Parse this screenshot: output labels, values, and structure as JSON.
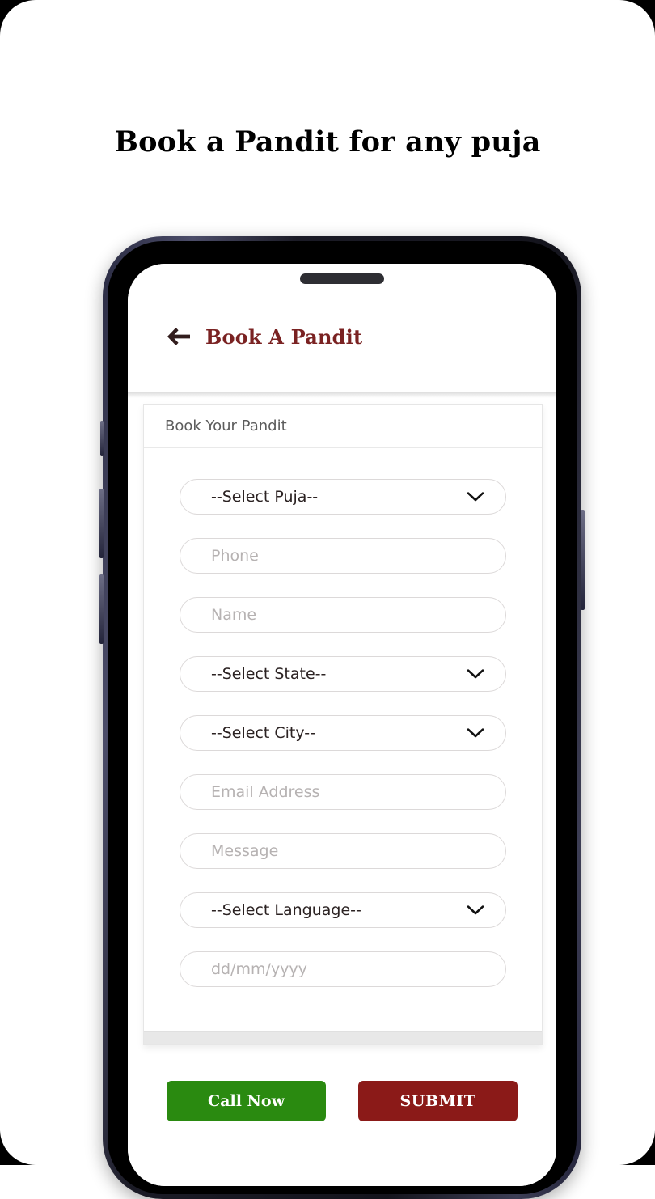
{
  "page": {
    "heading": "Book a Pandit for any puja",
    "background_color": "#ffffff"
  },
  "app": {
    "header": {
      "back_icon": "arrow-left-icon",
      "title": "Book A Pandit",
      "title_color": "#7a2222"
    },
    "card": {
      "header_title": "Book Your Pandit",
      "fields": [
        {
          "kind": "select",
          "value": "--Select Puja--",
          "icon": "chevron-down-icon"
        },
        {
          "kind": "input",
          "placeholder": "Phone"
        },
        {
          "kind": "input",
          "placeholder": "Name"
        },
        {
          "kind": "select",
          "value": "--Select State--",
          "icon": "chevron-down-icon"
        },
        {
          "kind": "select",
          "value": "--Select City--",
          "icon": "chevron-down-icon"
        },
        {
          "kind": "input",
          "placeholder": "Email Address"
        },
        {
          "kind": "input",
          "placeholder": "Message"
        },
        {
          "kind": "select",
          "value": "--Select Language--",
          "icon": "chevron-down-icon"
        },
        {
          "kind": "input",
          "placeholder": "dd/mm/yyyy"
        }
      ]
    },
    "actions": {
      "call_label": "Call Now",
      "call_color": "#2a8a10",
      "submit_label": "SUBMIT",
      "submit_color": "#8b1a18"
    }
  }
}
